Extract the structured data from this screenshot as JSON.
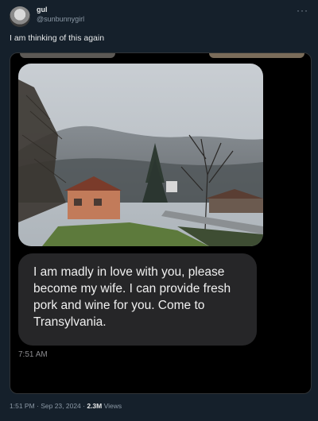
{
  "author": {
    "display_name": "gul",
    "handle": "@sunbunnygirl"
  },
  "tweet": {
    "text": "I am thinking of this again",
    "more_icon": "more-icon"
  },
  "embedded_chat": {
    "message": "I am madly in love with you, please become my wife. I can provide fresh pork and wine for you. Come to Transylvania.",
    "message_time": "7:51 AM"
  },
  "meta": {
    "posted": "1:51 PM · Sep 23, 2024 · ",
    "views_count": "2.3M",
    "views_label": " Views"
  },
  "colors": {
    "background": "#15202b",
    "bubble": "#262628",
    "secondary_text": "#8b98a5"
  }
}
